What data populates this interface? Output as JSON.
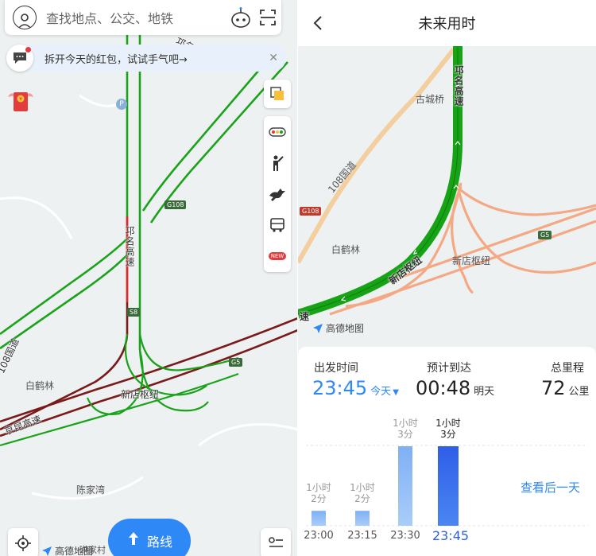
{
  "left": {
    "search": {
      "placeholder": "查找地点、公交、地铁"
    },
    "banner": {
      "text": "拆开今天的红包，试试手气吧→"
    },
    "map_labels": {
      "ring_road": "京昆高速",
      "west_road": "108国道",
      "qiming": "邛名高速",
      "junction": "新店枢纽",
      "baihelin": "白鹤林",
      "chenjiawan": "陈家湾",
      "top_road": "邛名高速",
      "shields": {
        "g108": "G108",
        "g5": "G5",
        "s8": "S8"
      }
    },
    "route_button": {
      "label": "路线"
    },
    "logo": {
      "text": "高德地图"
    },
    "partial_label": "洪家村",
    "toolbar": {
      "new_badge": "NEW"
    },
    "red_packet_symbol": "¥"
  },
  "right": {
    "header": {
      "title": "未来用时"
    },
    "map_labels": {
      "qiming": "邛名高速",
      "guchengqiao": "古城桥",
      "guodao": "108国道",
      "baihelin": "白鹤林",
      "junction_road": "新店枢纽",
      "junction": "新店枢纽",
      "partial": "速",
      "shields": {
        "g108": "G108",
        "g5": "G5"
      }
    },
    "logo": {
      "text": "高德地图"
    },
    "trip": {
      "depart_label": "出发时间",
      "depart_time": "23:45",
      "depart_day": "今天",
      "arrive_label": "预计到达",
      "arrive_time": "00:48",
      "arrive_day": "明天",
      "distance_label": "总里程",
      "distance": "72",
      "distance_unit": "公里"
    },
    "next_day_link": "查看后一天",
    "forecast": [
      {
        "time": "23:00",
        "duration_line1": "1小时",
        "duration_line2": "2分",
        "minutes": 62,
        "selected": false
      },
      {
        "time": "23:15",
        "duration_line1": "1小时",
        "duration_line2": "2分",
        "minutes": 62,
        "selected": false
      },
      {
        "time": "23:30",
        "duration_line1": "1小时",
        "duration_line2": "3分",
        "minutes": 63,
        "selected": false
      },
      {
        "time": "23:45",
        "duration_line1": "1小时",
        "duration_line2": "3分",
        "minutes": 63,
        "selected": true
      }
    ]
  },
  "colors": {
    "accent": "#2e88f5",
    "route_green": "#1aa31a",
    "traffic_red": "#d62b2b",
    "highway_orange": "#f4a883"
  }
}
